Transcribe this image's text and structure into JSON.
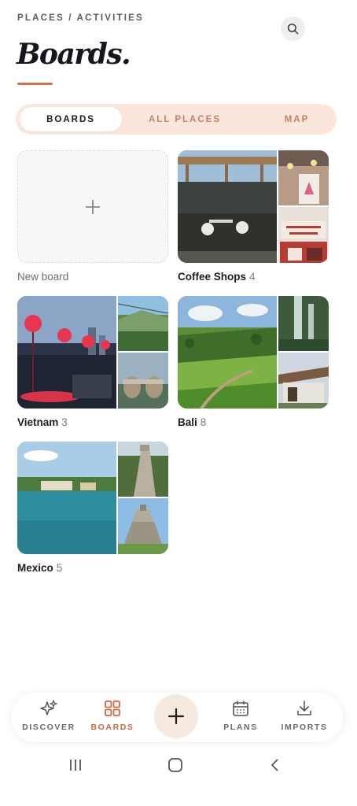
{
  "header": {
    "breadcrumb": "PLACES / ACTIVITIES",
    "title": "Boards.",
    "search_icon": "search-icon"
  },
  "tabs": [
    {
      "label": "BOARDS",
      "active": true
    },
    {
      "label": "ALL PLACES",
      "active": false
    },
    {
      "label": "MAP",
      "active": false
    }
  ],
  "new_board": {
    "label": "New board",
    "icon": "plus-icon"
  },
  "boards": [
    {
      "name": "Coffee Shops",
      "count": "4"
    },
    {
      "name": "Vietnam",
      "count": "3"
    },
    {
      "name": "Bali",
      "count": "8"
    },
    {
      "name": "Mexico",
      "count": "5"
    }
  ],
  "bottom_nav": {
    "items": [
      {
        "label": "DISCOVER",
        "icon": "sparkles-icon",
        "active": false
      },
      {
        "label": "BOARDS",
        "icon": "grid-icon",
        "active": true
      },
      {
        "label": "PLANS",
        "icon": "calendar-icon",
        "active": false
      },
      {
        "label": "IMPORTS",
        "icon": "download-icon",
        "active": false
      }
    ],
    "add_icon": "plus-icon"
  },
  "colors": {
    "accent": "#d0673f",
    "tab_bg": "#fbe6dc",
    "tab_inactive_text": "#c2826a",
    "fab_bg": "#f6e9dd"
  }
}
